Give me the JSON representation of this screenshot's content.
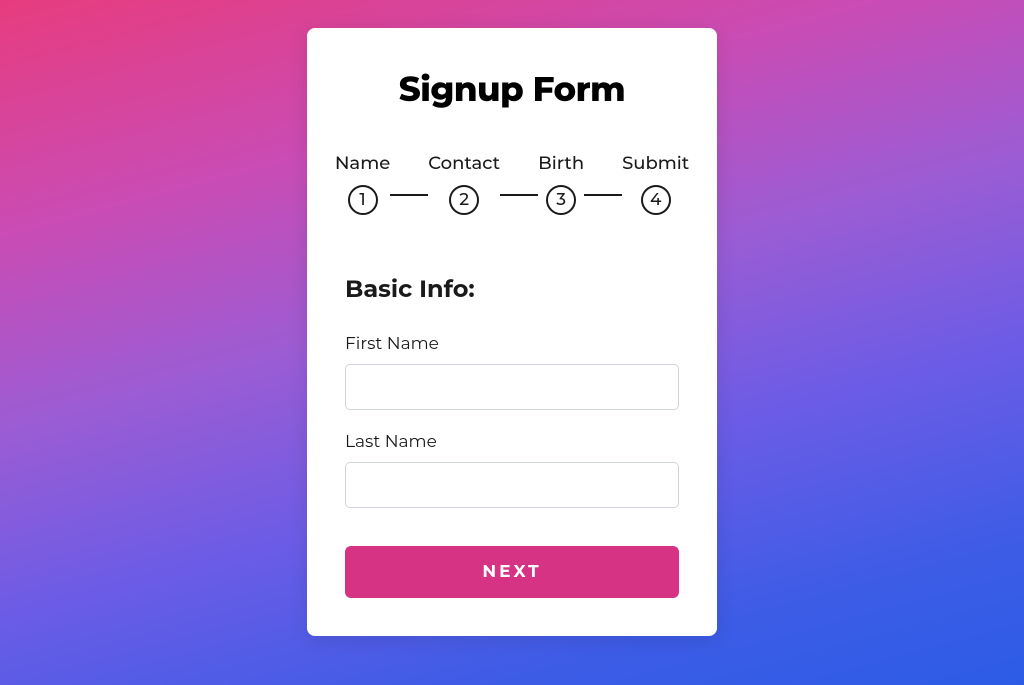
{
  "title": "Signup Form",
  "steps": [
    {
      "label": "Name",
      "number": "1"
    },
    {
      "label": "Contact",
      "number": "2"
    },
    {
      "label": "Birth",
      "number": "3"
    },
    {
      "label": "Submit",
      "number": "4"
    }
  ],
  "section": {
    "heading": "Basic Info:",
    "fields": [
      {
        "label": "First Name",
        "value": ""
      },
      {
        "label": "Last Name",
        "value": ""
      }
    ]
  },
  "button": {
    "next": "NEXT"
  }
}
